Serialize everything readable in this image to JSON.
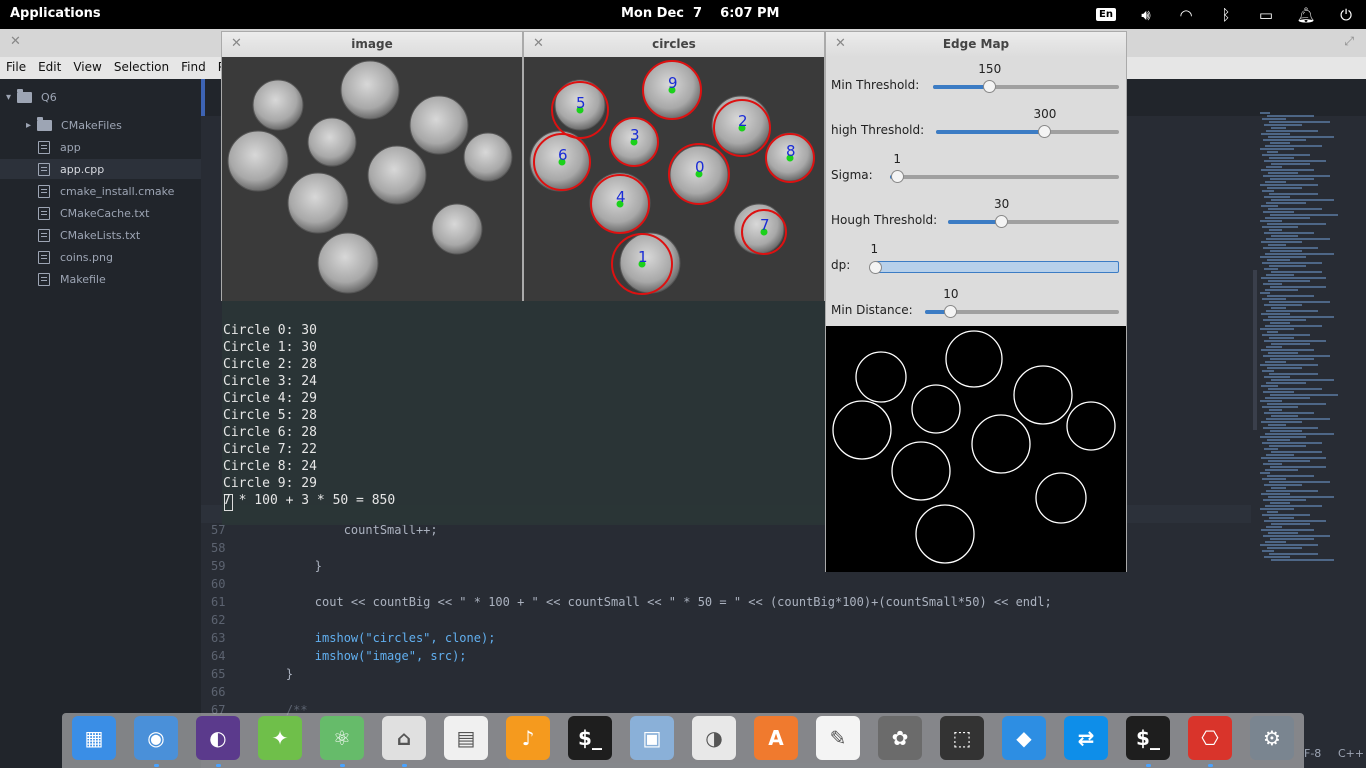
{
  "topbar": {
    "applications": "Applications",
    "clock": "Mon Dec  7    6:07 PM",
    "lang": "En",
    "tray_icons": [
      "volume-icon",
      "wifi-icon",
      "bluetooth-icon",
      "battery-icon",
      "notification-icon",
      "power-icon"
    ]
  },
  "editor": {
    "menu": [
      "File",
      "Edit",
      "View",
      "Selection",
      "Find",
      "Pack"
    ],
    "tree": {
      "root": "Q6",
      "items": [
        "CMakeFiles",
        "app",
        "app.cpp",
        "cmake_install.cmake",
        "CMakeCache.txt",
        "CMakeLists.txt",
        "coins.png",
        "Makefile"
      ]
    },
    "code_lines": [
      {
        "n": "57",
        "t": "            countSmall++;"
      },
      {
        "n": "58",
        "t": ""
      },
      {
        "n": "59",
        "t": "        }"
      },
      {
        "n": "60",
        "t": ""
      },
      {
        "n": "61",
        "t": "        cout << countBig << \" * 100 + \" << countSmall << \" * 50 = \" << (countBig*100)+(countSmall*50) << endl;"
      },
      {
        "n": "62",
        "t": ""
      },
      {
        "n": "63",
        "t": "        imshow(\"circles\", clone);"
      },
      {
        "n": "64",
        "t": "        imshow(\"image\", src);"
      },
      {
        "n": "65",
        "t": "    }"
      },
      {
        "n": "66",
        "t": ""
      },
      {
        "n": "67",
        "t": "    /**"
      }
    ],
    "status_right": [
      "F-8",
      "C++"
    ]
  },
  "windows": {
    "image": {
      "title": "image"
    },
    "circles": {
      "title": "circles",
      "labels": [
        "0",
        "1",
        "2",
        "3",
        "4",
        "5",
        "6",
        "7",
        "8",
        "9"
      ]
    },
    "edge_map": {
      "title": "Edge Map"
    }
  },
  "terminal": {
    "lines": [
      "Circle 0: 30",
      "Circle 1: 30",
      "Circle 2: 28",
      "Circle 3: 24",
      "Circle 4: 29",
      "Circle 5: 28",
      "Circle 6: 28",
      "Circle 7: 22",
      "Circle 8: 24",
      "Circle 9: 29",
      "7 * 100 + 3 * 50 = 850"
    ]
  },
  "controls": [
    {
      "label": "Min Threshold:",
      "value": "150",
      "fraction": 0.3
    },
    {
      "label": "high Threshold:",
      "value": "300",
      "fraction": 0.59
    },
    {
      "label": "Sigma:",
      "value": "1",
      "fraction": 0.03
    },
    {
      "label": "Hough Threshold:",
      "value": "30",
      "fraction": 0.31
    },
    {
      "label": "dp:",
      "value": "1",
      "fraction": 0.0
    },
    {
      "label": "Min Distance:",
      "value": "10",
      "fraction": 0.13
    }
  ],
  "dock": [
    {
      "name": "multitasking-view-icon",
      "color": "#3a8ee6",
      "glyph": "▦",
      "running": false
    },
    {
      "name": "chromium-icon",
      "color": "#4a90d9",
      "glyph": "◉",
      "running": true
    },
    {
      "name": "eclipse-icon",
      "color": "#5b3a8c",
      "glyph": "◐",
      "running": true
    },
    {
      "name": "android-studio-icon",
      "color": "#6fbf4a",
      "glyph": "✦",
      "running": false
    },
    {
      "name": "atom-icon",
      "color": "#66bb6a",
      "glyph": "⚛",
      "running": true
    },
    {
      "name": "files-icon",
      "color": "#e0e0e0",
      "glyph": "⌂",
      "running": true
    },
    {
      "name": "calendar-icon",
      "color": "#f0f0f0",
      "glyph": "▤",
      "running": false
    },
    {
      "name": "music-icon",
      "color": "#f59a1e",
      "glyph": "♪",
      "running": false
    },
    {
      "name": "terminal-icon",
      "color": "#1e1e1e",
      "glyph": "$_",
      "running": false
    },
    {
      "name": "photos-icon",
      "color": "#8ab0d8",
      "glyph": "▣",
      "running": false
    },
    {
      "name": "switchboard-toggle-icon",
      "color": "#e8e8e8",
      "glyph": "◑",
      "running": false
    },
    {
      "name": "appcenter-icon",
      "color": "#f07a2e",
      "glyph": "A",
      "running": false
    },
    {
      "name": "text-editor-icon",
      "color": "#f4f4f4",
      "glyph": "✎",
      "running": false
    },
    {
      "name": "gimp-icon",
      "color": "#6b6b6b",
      "glyph": "✿",
      "running": false
    },
    {
      "name": "screenshot-icon",
      "color": "#333333",
      "glyph": "⬚",
      "running": false
    },
    {
      "name": "dropbox-icon",
      "color": "#2d8ee3",
      "glyph": "◆",
      "running": false
    },
    {
      "name": "teamviewer-icon",
      "color": "#0e8ee9",
      "glyph": "⇄",
      "running": false
    },
    {
      "name": "terminal-2-icon",
      "color": "#1e1e1e",
      "glyph": "$_",
      "running": true
    },
    {
      "name": "pdf-viewer-icon",
      "color": "#d9342b",
      "glyph": "⎔",
      "running": true
    },
    {
      "name": "settings-icon",
      "color": "#7a8590",
      "glyph": "⚙",
      "running": false
    }
  ]
}
